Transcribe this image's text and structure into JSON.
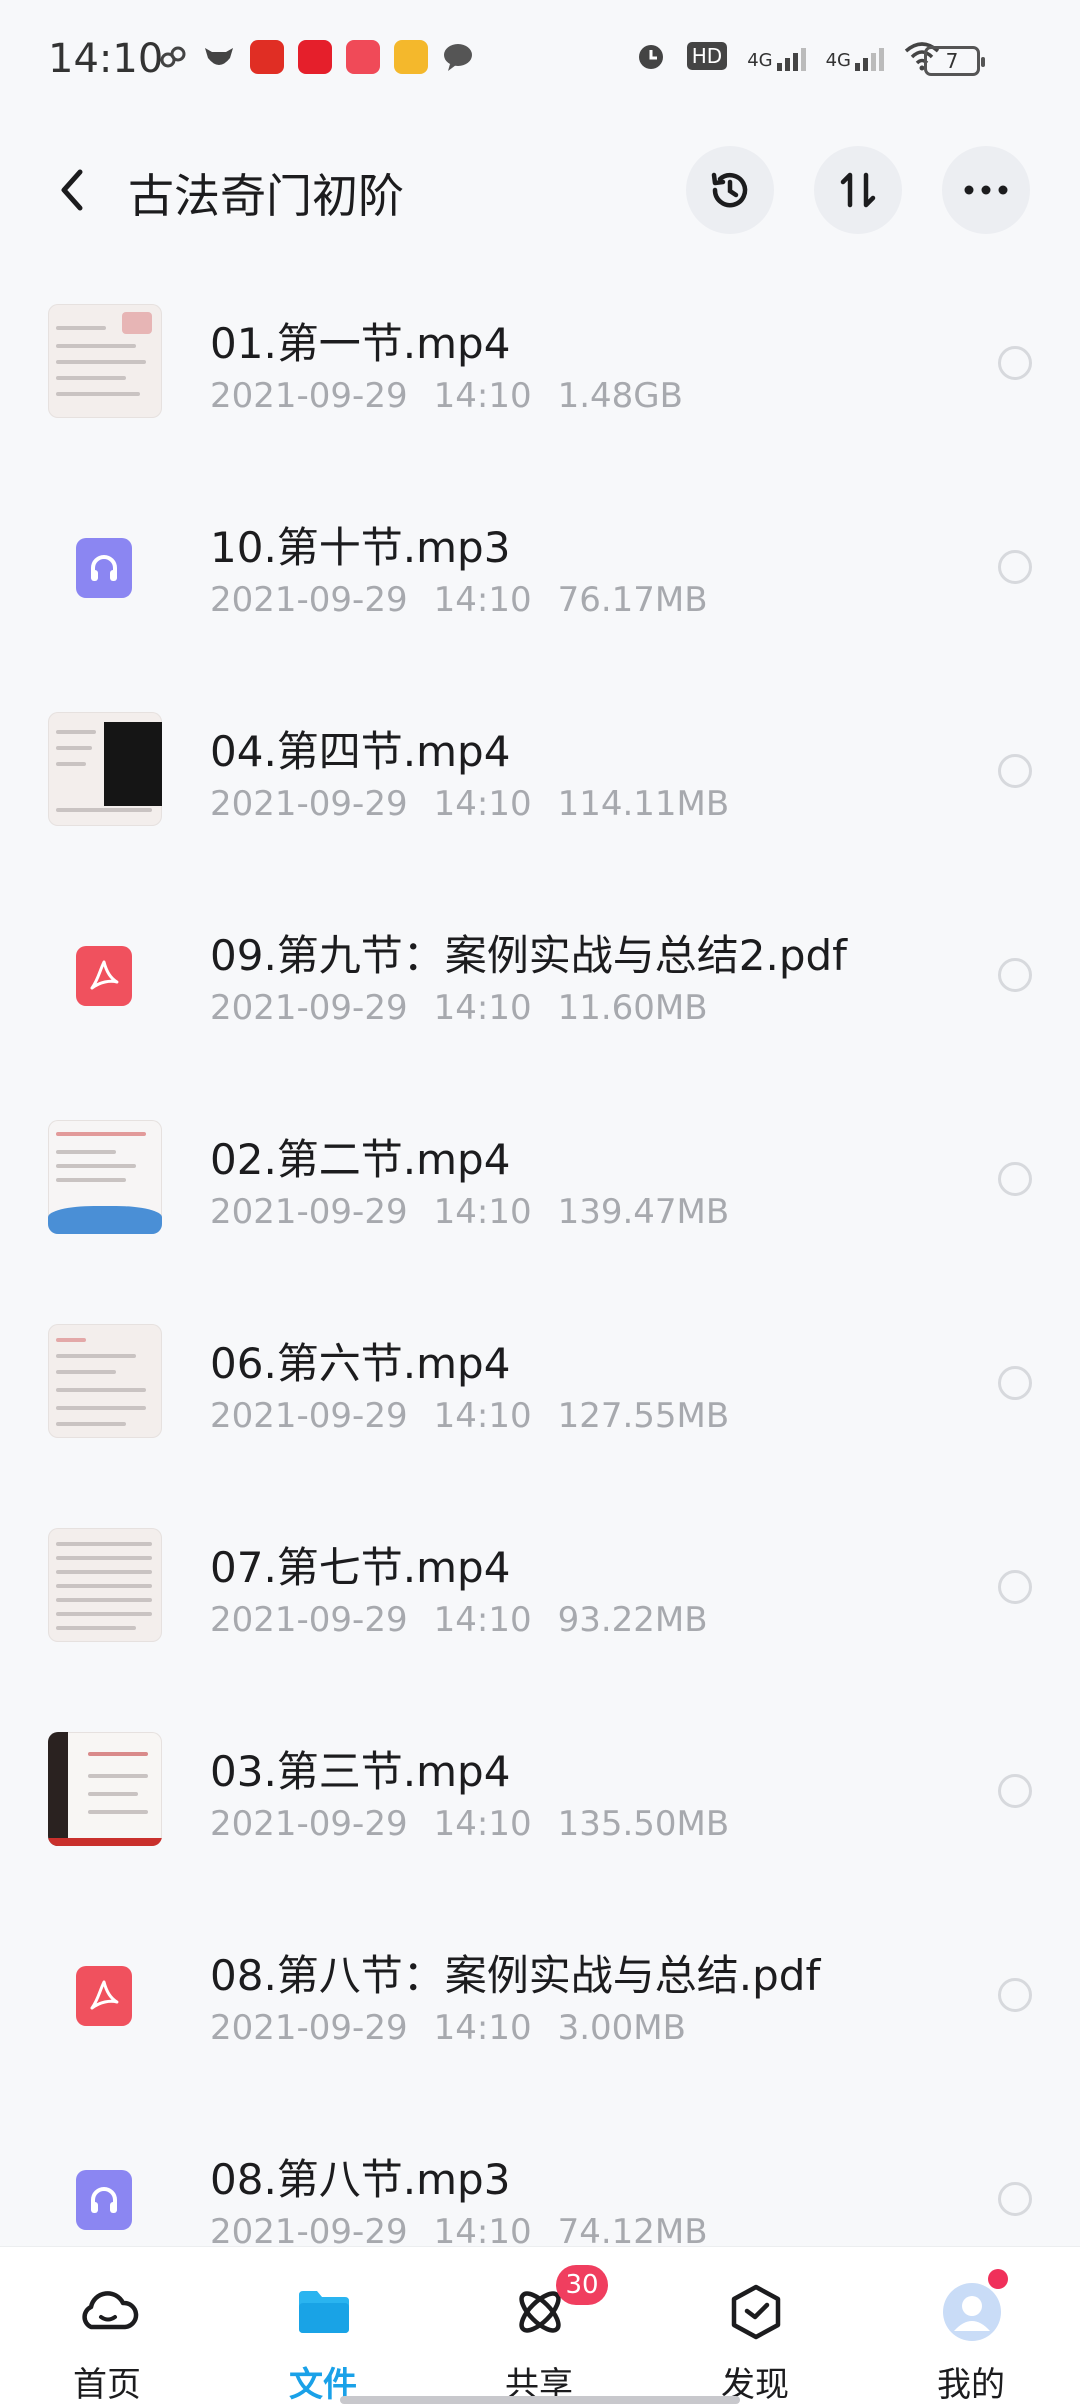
{
  "status_bar": {
    "time": "14:10",
    "hd_label": "HD",
    "signal1_label": "4G",
    "signal2_label": "4G",
    "battery": "7"
  },
  "header": {
    "title": "古法奇门初阶"
  },
  "files": [
    {
      "name": "01.第一节.mp4",
      "date": "2021-09-29",
      "time": "14:10",
      "size": "1.48GB",
      "kind": "video"
    },
    {
      "name": "10.第十节.mp3",
      "date": "2021-09-29",
      "time": "14:10",
      "size": "76.17MB",
      "kind": "audio"
    },
    {
      "name": "04.第四节.mp4",
      "date": "2021-09-29",
      "time": "14:10",
      "size": "114.11MB",
      "kind": "video"
    },
    {
      "name": "09.第九节：案例实战与总结2.pdf",
      "date": "2021-09-29",
      "time": "14:10",
      "size": "11.60MB",
      "kind": "pdf"
    },
    {
      "name": "02.第二节.mp4",
      "date": "2021-09-29",
      "time": "14:10",
      "size": "139.47MB",
      "kind": "video"
    },
    {
      "name": "06.第六节.mp4",
      "date": "2021-09-29",
      "time": "14:10",
      "size": "127.55MB",
      "kind": "video"
    },
    {
      "name": "07.第七节.mp4",
      "date": "2021-09-29",
      "time": "14:10",
      "size": "93.22MB",
      "kind": "video"
    },
    {
      "name": "03.第三节.mp4",
      "date": "2021-09-29",
      "time": "14:10",
      "size": "135.50MB",
      "kind": "video"
    },
    {
      "name": "08.第八节：案例实战与总结.pdf",
      "date": "2021-09-29",
      "time": "14:10",
      "size": "3.00MB",
      "kind": "pdf"
    },
    {
      "name": "08.第八节.mp3",
      "date": "2021-09-29",
      "time": "14:10",
      "size": "74.12MB",
      "kind": "audio"
    }
  ],
  "nav": {
    "items": [
      {
        "label": "首页",
        "icon": "cloud-home-icon",
        "active": false
      },
      {
        "label": "文件",
        "icon": "folder-icon",
        "active": true
      },
      {
        "label": "共享",
        "icon": "atom-share-icon",
        "active": false,
        "badge": "30"
      },
      {
        "label": "发现",
        "icon": "discover-icon",
        "active": false
      },
      {
        "label": "我的",
        "icon": "profile-avatar-icon",
        "active": false,
        "dot": true
      }
    ]
  },
  "colors": {
    "accent": "#1aa1e8",
    "badge": "#f03e5f",
    "audio_icon": "#8b86f2",
    "pdf_icon": "#f0515e",
    "meta_text": "#a7a9ae"
  }
}
